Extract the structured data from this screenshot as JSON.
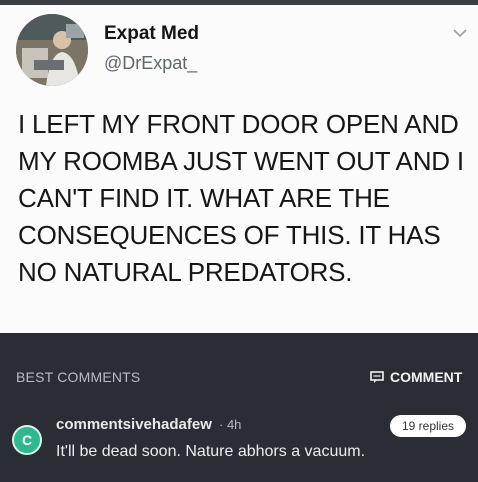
{
  "tweet": {
    "display_name": "Expat Med",
    "handle": "@DrExpat_",
    "text": "I LEFT MY FRONT DOOR OPEN AND MY ROOMBA JUST WENT OUT AND I CAN'T FIND IT. WHAT ARE THE CONSEQUENCES OF THIS. IT HAS NO NATURAL PREDATORS.",
    "menu_icon": "chevron-down-icon"
  },
  "comments_section": {
    "header_label": "BEST COMMENTS",
    "comment_button_label": "COMMENT",
    "comment_button_icon": "comment-icon"
  },
  "comment": {
    "avatar_letter": "C",
    "username": "commentsivehadafew",
    "time": "· 4h",
    "replies": "19 replies",
    "text": "It'll be dead soon. Nature abhors a vacuum."
  },
  "colors": {
    "card_background": "#fbfbfb",
    "dark_background": "#2a2d33",
    "avatar_green": "#2fb88d"
  }
}
